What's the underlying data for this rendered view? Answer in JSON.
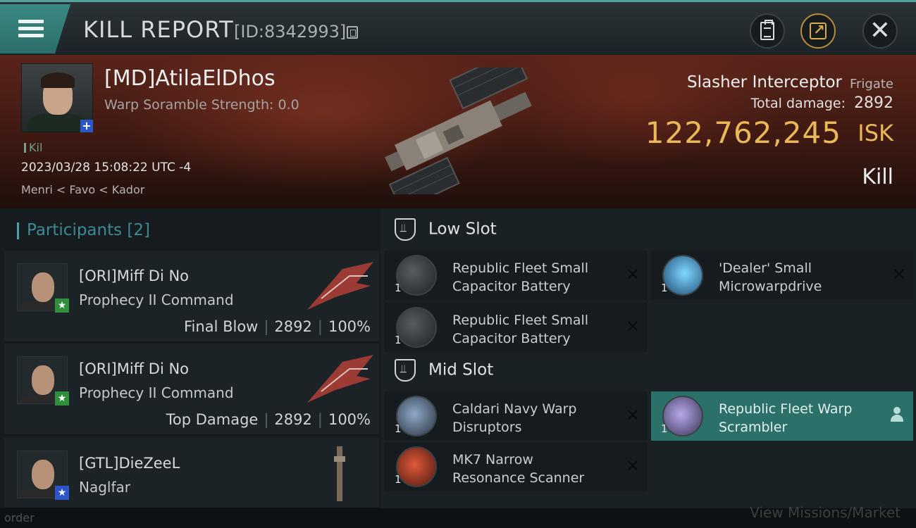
{
  "header": {
    "title": "KILL REPORT",
    "kill_id": "[ID:8342993]"
  },
  "victim": {
    "name": "[MD]AtilaElDhos",
    "scramble": "Warp Soramble Strength: 0.0",
    "tag": "Kil",
    "timestamp": "2023/03/28 15:08:22 UTC -4",
    "location": "Menri < Favo < Kador",
    "corp_badge": "+",
    "ship_name": "Slasher Interceptor",
    "ship_class": "Frigate",
    "damage_label": "Total damage:",
    "damage_value": "2892",
    "isk_value": "122,762,245",
    "isk_unit": "ISK",
    "result": "Kill"
  },
  "participants": {
    "title": "Participants",
    "count": "[2]",
    "rows": [
      {
        "name": "[ORI]Miff Di No",
        "ship": "Prophecy II Command",
        "role": "Final Blow",
        "damage": "2892",
        "percent": "100%",
        "badge": "★"
      },
      {
        "name": "[ORI]Miff Di No",
        "ship": "Prophecy II Command",
        "role": "Top Damage",
        "damage": "2892",
        "percent": "100%",
        "badge": "★"
      },
      {
        "name": "[GTL]DieZeeL",
        "ship": "Naglfar",
        "badge": "★"
      }
    ]
  },
  "fitting": {
    "low_slot": "Low Slot",
    "mid_slot": "Mid Slot",
    "modules": [
      {
        "qty": "1",
        "name": "Republic Fleet Small Capacitor Battery",
        "x": "✕"
      },
      {
        "qty": "1",
        "name": "'Dealer' Small Microwarpdrive",
        "x": "✕"
      },
      {
        "qty": "1",
        "name": "Republic Fleet Small Capacitor Battery",
        "x": "✕"
      },
      {
        "qty": "1",
        "name": "Caldari Navy Warp Disruptors",
        "x": "✕"
      },
      {
        "qty": "1",
        "name": "Republic Fleet Warp Scrambler",
        "x": "✕"
      },
      {
        "qty": "1",
        "name": "MK7 Narrow Resonance Scanner",
        "x": "✕"
      }
    ]
  },
  "footer": {
    "left": "order",
    "right": "View Missions/Market"
  },
  "colors": {
    "accent_teal": "#3b8a84",
    "isk_gold": "#e9b857",
    "highlight_row": "#2b7169"
  }
}
